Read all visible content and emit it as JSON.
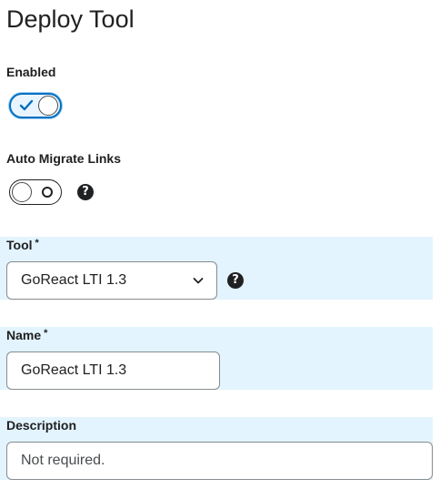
{
  "page": {
    "title": "Deploy Tool"
  },
  "form": {
    "enabled": {
      "label": "Enabled",
      "state": true
    },
    "auto_migrate_links": {
      "label": "Auto Migrate Links",
      "state": false
    },
    "tool": {
      "label": "Tool",
      "required_marker": "*",
      "selected": "GoReact LTI 1.3"
    },
    "name": {
      "label": "Name",
      "required_marker": "*",
      "value": "GoReact LTI 1.3"
    },
    "description": {
      "label": "Description",
      "placeholder": "Not required."
    }
  },
  "icons": {
    "help": "question-circle",
    "check": "checkmark",
    "chevron": "chevron-down"
  },
  "colors": {
    "accent": "#006fbf",
    "band_highlight": "#e3f4fe",
    "text": "#202122"
  }
}
